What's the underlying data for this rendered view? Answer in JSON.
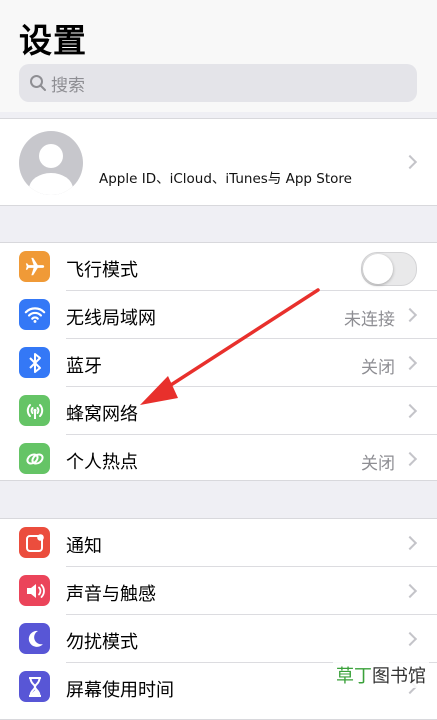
{
  "title": "设置",
  "search": {
    "placeholder": "搜索",
    "icon": "search-icon"
  },
  "profile": {
    "text": "Apple ID、iCloud、iTunes与 App Store"
  },
  "group1": [
    {
      "label": "飞行模式",
      "icon": "airplane-icon",
      "color": "#f09a37",
      "toggle": "off"
    },
    {
      "label": "无线局域网",
      "icon": "wifi-icon",
      "color": "#3478f6",
      "value": "未连接"
    },
    {
      "label": "蓝牙",
      "icon": "bluetooth-icon",
      "color": "#3478f6",
      "value": "关闭"
    },
    {
      "label": "蜂窝网络",
      "icon": "cellular-icon",
      "color": "#65c466"
    },
    {
      "label": "个人热点",
      "icon": "hotspot-icon",
      "color": "#65c466",
      "value": "关闭"
    }
  ],
  "group2": [
    {
      "label": "通知",
      "icon": "notification-icon",
      "color": "#eb4d3d"
    },
    {
      "label": "声音与触感",
      "icon": "sound-icon",
      "color": "#eb445a"
    },
    {
      "label": "勿扰模式",
      "icon": "moon-icon",
      "color": "#5856d6"
    },
    {
      "label": "屏幕使用时间",
      "icon": "hourglass-icon",
      "color": "#5856d6"
    }
  ],
  "watermark": {
    "part1": "草丁",
    "part2": "图书馆"
  }
}
